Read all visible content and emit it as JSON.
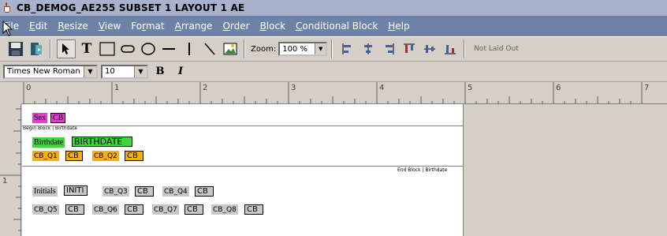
{
  "window": {
    "title": "CB_DEMOG_AE255 SUBSET 1 LAYOUT 1 AE"
  },
  "menu": {
    "items": [
      {
        "pre": "",
        "mn": "F",
        "post": "ile"
      },
      {
        "pre": "",
        "mn": "E",
        "post": "dit"
      },
      {
        "pre": "",
        "mn": "R",
        "post": "esize"
      },
      {
        "pre": "",
        "mn": "V",
        "post": "iew"
      },
      {
        "pre": "Fo",
        "mn": "r",
        "post": "mat"
      },
      {
        "pre": "",
        "mn": "A",
        "post": "rrange"
      },
      {
        "pre": "",
        "mn": "O",
        "post": "rder"
      },
      {
        "pre": "",
        "mn": "B",
        "post": "lock"
      },
      {
        "pre": "",
        "mn": "C",
        "post": "onditional Block"
      },
      {
        "pre": "",
        "mn": "H",
        "post": "elp"
      }
    ]
  },
  "toolbar": {
    "zoom_label": "Zoom:",
    "zoom_value": "100 %",
    "status": "Not Laid Out",
    "icons": [
      "save-icon",
      "open-icon",
      "select-arrow-icon",
      "text-tool-icon",
      "rectangle-tool-icon",
      "rounded-rect-tool-icon",
      "ellipse-tool-icon",
      "horizontal-line-tool-icon",
      "vertical-line-tool-icon",
      "diagonal-line-tool-icon",
      "image-tool-icon",
      "align-left-icon",
      "align-center-icon",
      "align-right-icon",
      "align-top-icon",
      "align-middle-icon",
      "align-bottom-icon"
    ]
  },
  "fontbar": {
    "font_name": "Times New Roman",
    "font_size": "10",
    "bold": "B",
    "italic": "I"
  },
  "ruler": {
    "h_labels": [
      "0",
      "1",
      "2",
      "3",
      "4",
      "5",
      "6",
      "7"
    ],
    "v_labels": [
      "1"
    ]
  },
  "canvas": {
    "sex_label": "Sex",
    "sex_value": "CB",
    "begin_block": "Begin Block | Birthdate",
    "birthdate_label": "Birthdate",
    "birthdate_value": "BIRTHDATE",
    "q1_label": "CB_Q1",
    "q1_value": "CB",
    "q2_label": "CB_Q2",
    "q2_value": "CB",
    "end_block": "End Block | Birthdate",
    "initials_label": "Initials",
    "initials_value": "INITI",
    "q3_label": "CB_Q3",
    "q3_value": "CB",
    "q4_label": "CB_Q4",
    "q4_value": "CB",
    "q5_label": "CB_Q5",
    "q5_value": "CB",
    "q6_label": "CB_Q6",
    "q6_value": "CB",
    "q7_label": "CB_Q7",
    "q7_value": "CB",
    "q8_label": "CB_Q8",
    "q8_value": "CB"
  },
  "colors": {
    "menubar": "#6e82a8",
    "titlebar": "#a8b2cc",
    "magenta": "#e040d0",
    "green": "#3ad83a",
    "orange": "#f4b010",
    "gray": "#c8c8c8"
  }
}
